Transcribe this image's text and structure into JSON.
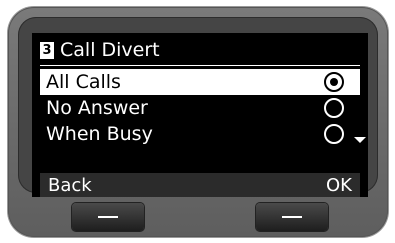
{
  "header": {
    "menu_number": "3",
    "title": "Call Divert"
  },
  "options": [
    {
      "label": "All Calls",
      "selected": true
    },
    {
      "label": "No Answer",
      "selected": false
    },
    {
      "label": "When Busy",
      "selected": false
    }
  ],
  "softkeys": {
    "left": "Back",
    "right": "OK"
  },
  "icons": {
    "radio_selected": "radio-selected-icon",
    "radio_unselected": "radio-unselected-icon",
    "scroll_down": "scroll-down-arrow-icon",
    "softkey": "dash-icon"
  },
  "colors": {
    "screen_bg": "#000000",
    "highlight": "#ffffff",
    "softbar_bg": "#2b2b2b"
  }
}
